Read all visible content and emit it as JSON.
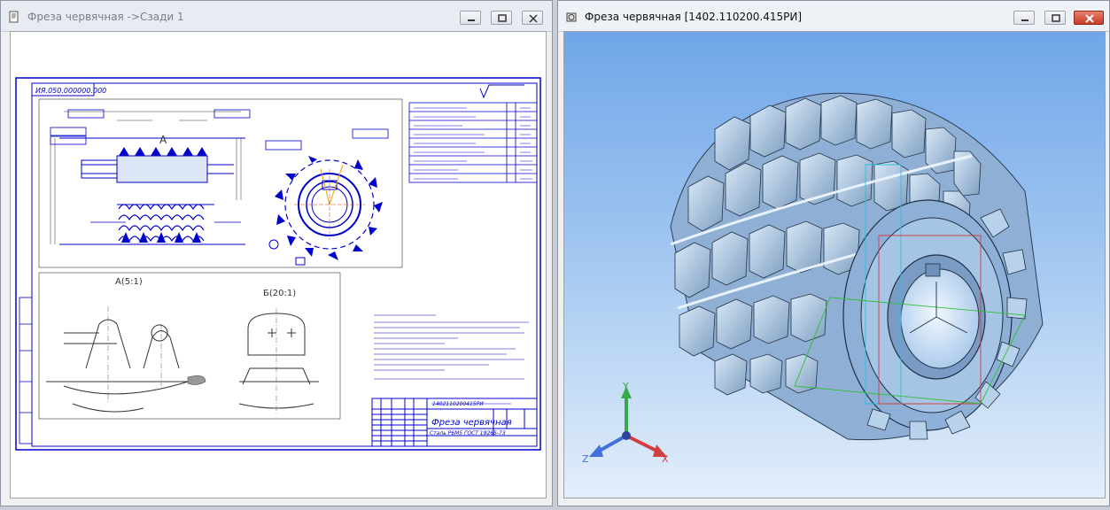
{
  "left_window": {
    "title": "Фреза червячная ->Сзади 1",
    "drawing": {
      "code": "ИЯ.050.000000.000",
      "view_a": "А(5:1)",
      "view_b": "Б(20:1)",
      "title_block_name": "Фреза червячная",
      "title_block_code": "1402110200415РИ",
      "material": "Сталь Р6М5 ГОСТ 19265-73"
    }
  },
  "right_window": {
    "title": "Фреза червячная [1402.110200.415РИ]",
    "axes": {
      "x": "X",
      "y": "Y",
      "z": "Z"
    }
  },
  "colors": {
    "drawing_line": "#0000cc",
    "model_fill": "#9fc3e6",
    "bg_top": "#6fa6e8"
  }
}
